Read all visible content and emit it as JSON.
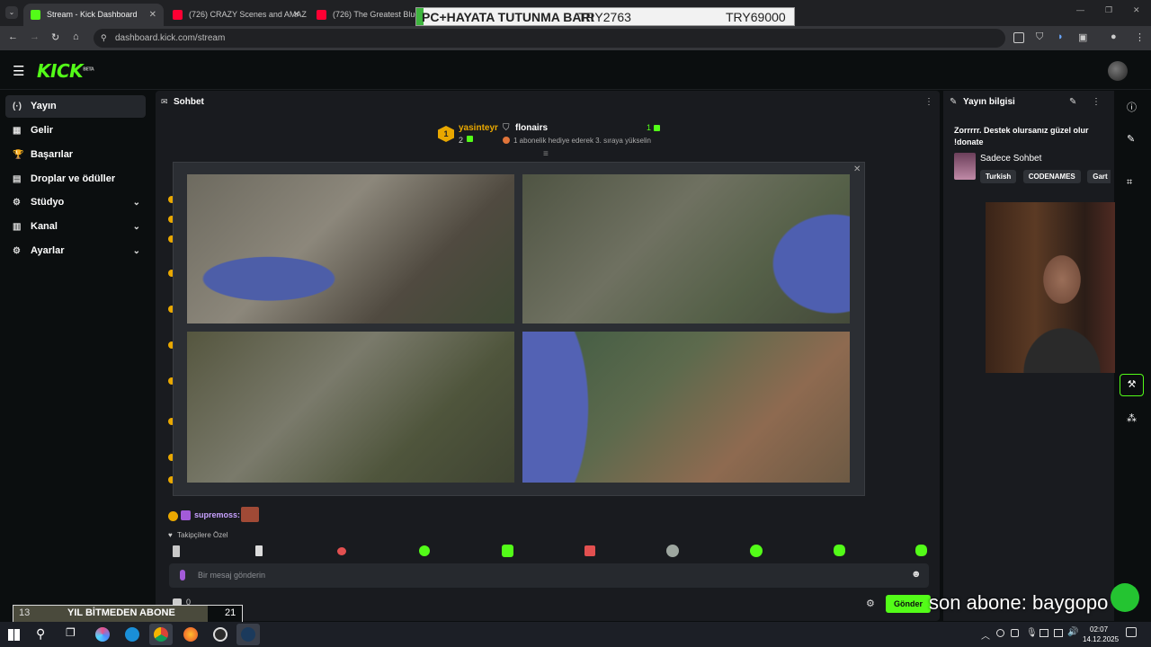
{
  "browser": {
    "tabs": [
      {
        "label": "Stream - Kick Dashboard",
        "active": true,
        "favicon_color": "#53fc18"
      },
      {
        "label": "(726) CRAZY Scenes and AMAZ",
        "active": false,
        "favicon_color": "#ff0033"
      },
      {
        "label": "(726) The Greatest Blues Ba",
        "active": false,
        "favicon_color": "#ff0033"
      }
    ],
    "url": "dashboard.kick.com/stream"
  },
  "overlay_banner": {
    "left_text": "PC+HAYATA TUTUNMA BARI",
    "mid_text": "TRY2763",
    "right_text": "TRY69000"
  },
  "app": {
    "logo": "KICK",
    "logo_sup": "BETA"
  },
  "sidebar": {
    "items": [
      {
        "label": "Yayın",
        "icon": "(·)",
        "active": true,
        "chevron": false
      },
      {
        "label": "Gelir",
        "icon": "▦",
        "active": false,
        "chevron": false
      },
      {
        "label": "Başarılar",
        "icon": "🏆",
        "active": false,
        "chevron": false
      },
      {
        "label": "Droplar ve ödüller",
        "icon": "▤",
        "active": false,
        "chevron": false
      },
      {
        "label": "Stüdyo",
        "icon": "⚙",
        "active": false,
        "chevron": true
      },
      {
        "label": "Kanal",
        "icon": "▥",
        "active": false,
        "chevron": true
      },
      {
        "label": "Ayarlar",
        "icon": "⚙",
        "active": false,
        "chevron": true
      }
    ]
  },
  "chat": {
    "title": "Sohbet",
    "leaderboard": {
      "first": {
        "rank": "1",
        "name": "yasinteyr",
        "count": "2"
      },
      "second": {
        "name": "flonairs",
        "count": "1",
        "note": "1 abonelik hediye ederek 3. sıraya yükselin"
      }
    },
    "last_message_user": "supremoss:",
    "followers_label": "Takipçilere Özel",
    "input_placeholder": "Bir mesaj gönderin",
    "send_label": "Gönder",
    "points": "0"
  },
  "stream_info": {
    "title": "Yayın bilgisi",
    "stream_title": "Zorrrrr. Destek olursanız güzel olur !donate",
    "category": "Sadece Sohbet",
    "tags": [
      "Turkish",
      "CODENAMES",
      "Gart"
    ]
  },
  "overlays": {
    "subgoal_left": "13",
    "subgoal_text": "YIL BİTMEDEN ABONE",
    "subgoal_right": "21",
    "last_sub": "son abone: baygopo"
  },
  "taskbar": {
    "time": "02:07",
    "date": "14.12.2025"
  },
  "colors": {
    "accent": "#53fc18",
    "gold": "#e9a800",
    "panel": "#191b1f"
  }
}
